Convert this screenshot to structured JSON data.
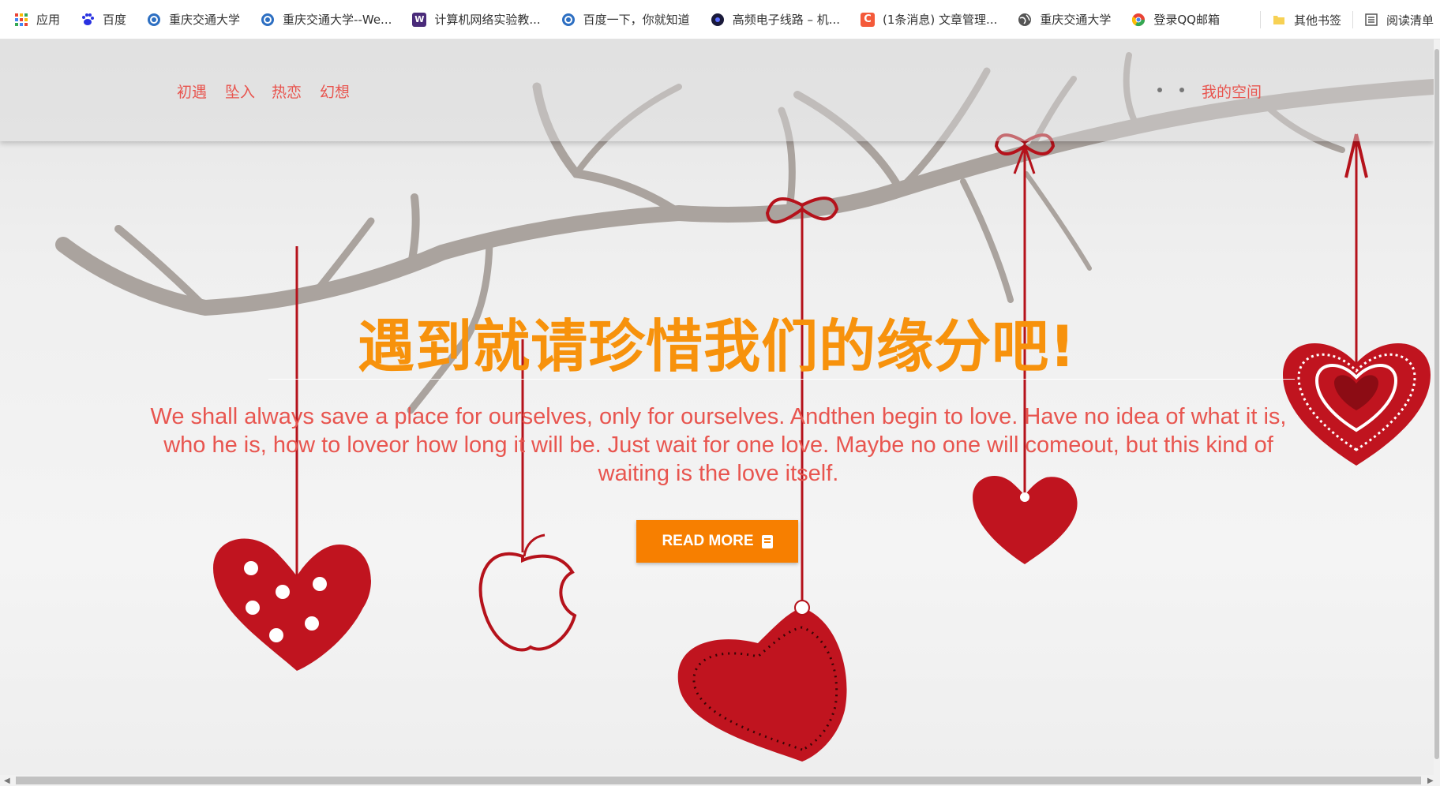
{
  "bookmarks": {
    "items": [
      {
        "label": "应用",
        "icon": "apps-grid-icon"
      },
      {
        "label": "百度",
        "icon": "baidu-paw-icon"
      },
      {
        "label": "重庆交通大学",
        "icon": "university-seal-icon"
      },
      {
        "label": "重庆交通大学--We...",
        "icon": "university-seal-icon"
      },
      {
        "label": "计算机网络实验教...",
        "icon": "w-logo-icon"
      },
      {
        "label": "百度一下，你就知道",
        "icon": "university-seal-icon"
      },
      {
        "label": "高频电子线路 – 机...",
        "icon": "dark-circle-icon"
      },
      {
        "label": "(1条消息) 文章管理...",
        "icon": "csdn-c-icon"
      },
      {
        "label": "重庆交通大学",
        "icon": "globe-icon"
      },
      {
        "label": "登录QQ邮箱",
        "icon": "chrome-icon"
      }
    ],
    "other_label": "其他书签",
    "reading_list_label": "阅读清单"
  },
  "nav": {
    "links": [
      "初遇",
      "坠入",
      "热恋",
      "幻想"
    ],
    "space_link": "我的空间"
  },
  "hero": {
    "title": "遇到就请珍惜我们的缘分吧!",
    "text": "We shall always save a place for ourselves, only for ourselves. Andthen begin to love. Have no idea of what it is, who he is, how to loveor how long it will be. Just wait for one love. Maybe no one will comeout, but this kind of waiting is the love itself.",
    "button": "READ MORE"
  },
  "colors": {
    "accent_orange": "#f77f00",
    "title_orange": "#f7920c",
    "link_red": "#e8554f",
    "heart_red": "#b5121b"
  }
}
